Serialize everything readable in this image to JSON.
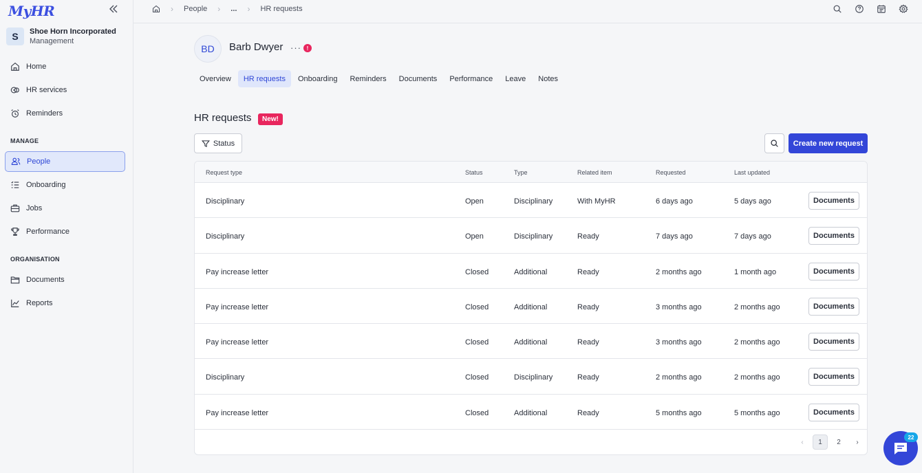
{
  "brand": {
    "logo": "MyHR",
    "accent": "#3346d8",
    "alert": "#e8265e"
  },
  "org": {
    "initial": "S",
    "name": "Shoe Horn Incorporated",
    "role": "Management"
  },
  "sidebar": {
    "main_items": [
      {
        "label": "Home",
        "icon": "home-icon"
      },
      {
        "label": "HR services",
        "icon": "hr-services-icon"
      },
      {
        "label": "Reminders",
        "icon": "alarm-icon"
      }
    ],
    "manage_title": "MANAGE",
    "manage_items": [
      {
        "label": "People",
        "icon": "people-icon",
        "active": true
      },
      {
        "label": "Onboarding",
        "icon": "checklist-icon"
      },
      {
        "label": "Jobs",
        "icon": "briefcase-icon"
      },
      {
        "label": "Performance",
        "icon": "trophy-icon"
      }
    ],
    "org_title": "ORGANISATION",
    "org_items": [
      {
        "label": "Documents",
        "icon": "folder-icon"
      },
      {
        "label": "Reports",
        "icon": "chart-icon"
      }
    ]
  },
  "breadcrumb": {
    "people": "People",
    "ellipsis": "...",
    "current": "HR requests"
  },
  "profile": {
    "initials": "BD",
    "name": "Barb Dwyer",
    "menu": "···",
    "alert": "!"
  },
  "tabs": [
    "Overview",
    "HR requests",
    "Onboarding",
    "Reminders",
    "Documents",
    "Performance",
    "Leave",
    "Notes"
  ],
  "active_tab": "HR requests",
  "section": {
    "title": "HR requests",
    "badge": "New!",
    "status_filter": "Status",
    "create_button": "Create new request"
  },
  "table": {
    "headers": [
      "Request type",
      "Status",
      "Type",
      "Related item",
      "Requested",
      "Last updated"
    ],
    "rows": [
      [
        "Disciplinary",
        "Open",
        "Disciplinary",
        "With MyHR",
        "6 days ago",
        "5 days ago"
      ],
      [
        "Disciplinary",
        "Open",
        "Disciplinary",
        "Ready",
        "7 days ago",
        "7 days ago"
      ],
      [
        "Pay increase letter",
        "Closed",
        "Additional",
        "Ready",
        "2 months ago",
        "1 month ago"
      ],
      [
        "Pay increase letter",
        "Closed",
        "Additional",
        "Ready",
        "3 months ago",
        "2 months ago"
      ],
      [
        "Pay increase letter",
        "Closed",
        "Additional",
        "Ready",
        "3 months ago",
        "2 months ago"
      ],
      [
        "Disciplinary",
        "Closed",
        "Disciplinary",
        "Ready",
        "2 months ago",
        "2 months ago"
      ],
      [
        "Pay increase letter",
        "Closed",
        "Additional",
        "Ready",
        "5 months ago",
        "5 months ago"
      ]
    ],
    "row_action": "Documents"
  },
  "pagination": {
    "prev": "‹",
    "pages": [
      "1",
      "2"
    ],
    "current": "1",
    "next": "›"
  },
  "chat": {
    "badge": "22"
  }
}
